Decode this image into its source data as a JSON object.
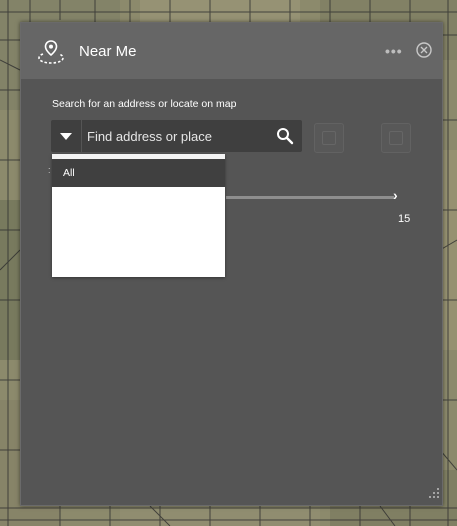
{
  "widget": {
    "title": "Near Me",
    "more_icon": "more-icon",
    "more_text": "•••",
    "close_icon": "close-icon"
  },
  "search": {
    "label": "Search for an address or locate on map",
    "placeholder": "Find address or place",
    "dropdown_options": [
      "All"
    ],
    "selected_source": "All"
  },
  "buffer": {
    "value": "15",
    "next_icon": "chevron-right-icon",
    "next_text": "›"
  },
  "colors": {
    "panel_bg": "#555555",
    "header_bg": "#666666",
    "input_bg": "#3f3f3f",
    "dropdown_selected": "#404040"
  }
}
